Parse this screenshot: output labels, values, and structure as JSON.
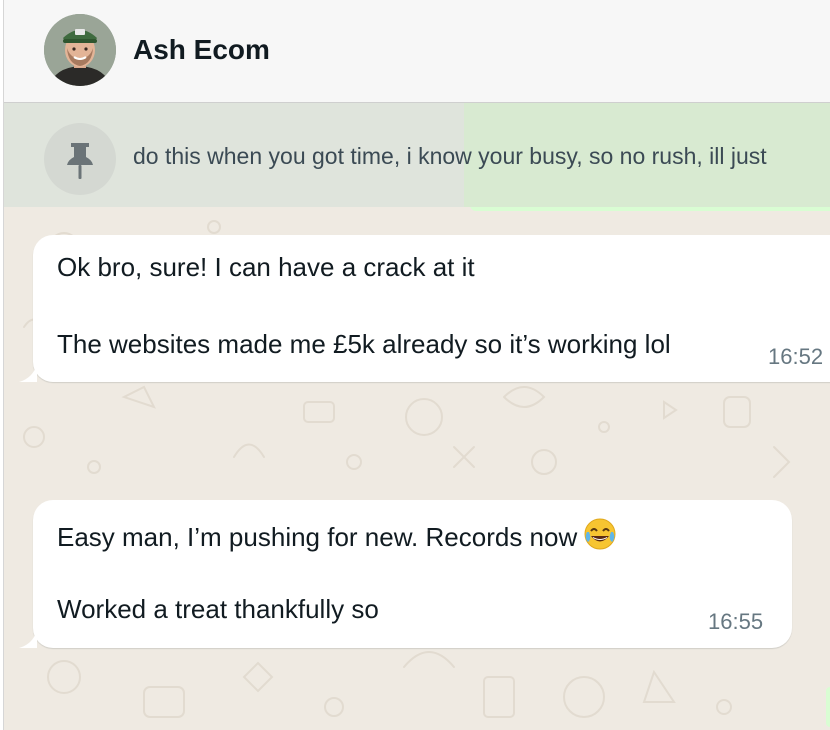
{
  "header": {
    "contact_name": "Ash Ecom",
    "avatar_icon": "contact-avatar-photo"
  },
  "pinned": {
    "icon": "pin-icon",
    "text": "do this when you got time, i know your busy, so no rush, ill just"
  },
  "messages": [
    {
      "direction": "incoming",
      "lines": [
        "Ok bro, sure! I can have a crack at it",
        "The websites made me £5k already so it’s working lol"
      ],
      "time": "16:52"
    },
    {
      "direction": "incoming",
      "lines": [
        "Easy man, I’m pushing for new. Records now",
        "Worked a treat thankfully so"
      ],
      "emoji": "face-with-tears-of-joy-emoji",
      "time": "16:55"
    }
  ],
  "colors": {
    "chat_background": "#efeae2",
    "incoming_bubble": "#ffffff",
    "outgoing_bubble": "#d9fdd3",
    "header_background": "#f7f7f7",
    "text_primary": "#111b21",
    "text_secondary": "#667781"
  }
}
